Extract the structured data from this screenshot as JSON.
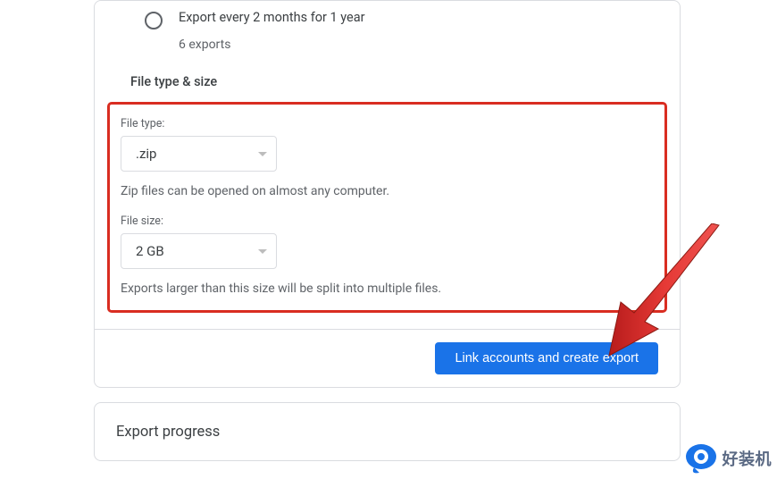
{
  "radio_option": {
    "label": "Export every 2 months for 1 year",
    "sublabel": "6 exports"
  },
  "file_section": {
    "header": "File type & size",
    "file_type_label": "File type:",
    "file_type_value": ".zip",
    "file_type_hint": "Zip files can be opened on almost any computer.",
    "file_size_label": "File size:",
    "file_size_value": "2 GB",
    "file_size_hint": "Exports larger than this size will be split into multiple files."
  },
  "action_button": "Link accounts and create export",
  "progress_section": "Export progress",
  "watermark": "好装机",
  "colors": {
    "highlight_border": "#d92d21",
    "primary": "#1a73e8",
    "arrow": "#d92d21"
  }
}
